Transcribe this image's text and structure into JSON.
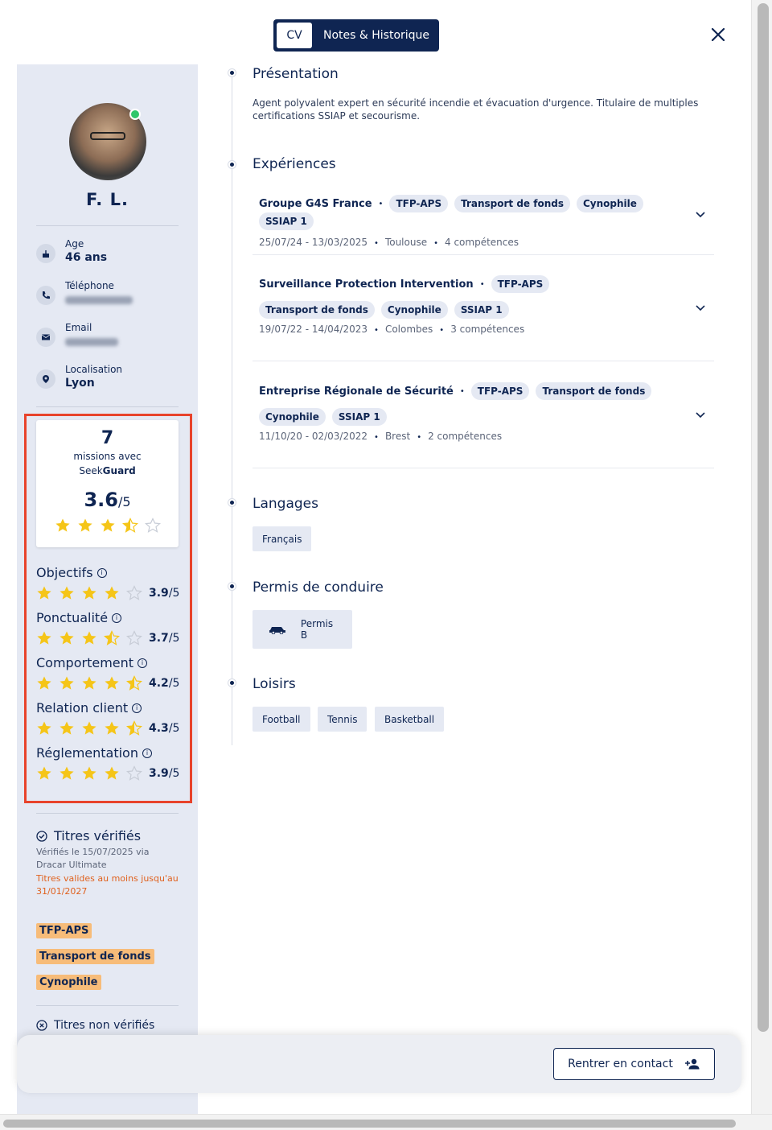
{
  "toggle": {
    "cv": "CV",
    "notes": "Notes & Historique"
  },
  "profile": {
    "name": "F. L.",
    "age_label": "Age",
    "age_value": "46 ans",
    "phone_label": "Téléphone",
    "email_label": "Email",
    "location_label": "Localisation",
    "location_value": "Lyon"
  },
  "missions": {
    "count": "7",
    "label": "missions avec",
    "brand_prefix": "Seek",
    "brand_bold": "Guard",
    "score": "3.6",
    "score_suffix": "/5",
    "rating": 3.6
  },
  "criteria": [
    {
      "label": "Objectifs",
      "score": "3.9",
      "suffix": "/5",
      "rating": 3.9
    },
    {
      "label": "Ponctualité",
      "score": "3.7",
      "suffix": "/5",
      "rating": 3.7
    },
    {
      "label": "Comportement",
      "score": "4.2",
      "suffix": "/5",
      "rating": 4.2
    },
    {
      "label": "Relation client",
      "score": "4.3",
      "suffix": "/5",
      "rating": 4.3
    },
    {
      "label": "Réglementation",
      "score": "3.9",
      "suffix": "/5",
      "rating": 3.9
    }
  ],
  "titres": {
    "verified_title": "Titres vérifiés",
    "verified_sub": "Vérifiés le 15/07/2025 via Dracar Ultimate",
    "valid_until": "Titres valides au moins jusqu'au 31/01/2027",
    "tags": [
      "TFP-APS",
      "Transport de fonds",
      "Cynophile"
    ],
    "non_verified_title": "Titres non vérifiés"
  },
  "sections": {
    "presentation_title": "Présentation",
    "presentation_text": "Agent polyvalent expert en sécurité incendie et évacuation d'urgence. Titulaire de multiples certifications SSIAP et secourisme.",
    "experiences_title": "Expériences",
    "languages_title": "Langages",
    "license_title": "Permis de conduire",
    "leisure_title": "Loisirs"
  },
  "experiences": [
    {
      "company": "Groupe G4S France",
      "tags": [
        "TFP-APS",
        "Transport de fonds",
        "Cynophile",
        "SSIAP 1"
      ],
      "dates": "25/07/24 - 13/03/2025",
      "city": "Toulouse",
      "skills": "4 compétences"
    },
    {
      "company": "Surveillance Protection Intervention",
      "tags": [
        "TFP-APS",
        "Transport de fonds",
        "Cynophile",
        "SSIAP 1"
      ],
      "dates": "19/07/22 - 14/04/2023",
      "city": "Colombes",
      "skills": "3 compétences"
    },
    {
      "company": "Entreprise Régionale de Sécurité",
      "tags": [
        "TFP-APS",
        "Transport de fonds",
        "Cynophile",
        "SSIAP 1"
      ],
      "dates": "11/10/20 - 02/03/2022",
      "city": "Brest",
      "skills": "2 compétences"
    }
  ],
  "languages": [
    "Français"
  ],
  "license": "Permis B",
  "leisure": [
    "Football",
    "Tennis",
    "Basketball"
  ],
  "contact_button": "Rentrer en contact",
  "colors": {
    "navy": "#0f2552",
    "star": "#f5c518",
    "highlight": "#e8432b",
    "tag_orange": "#f7bc79"
  }
}
